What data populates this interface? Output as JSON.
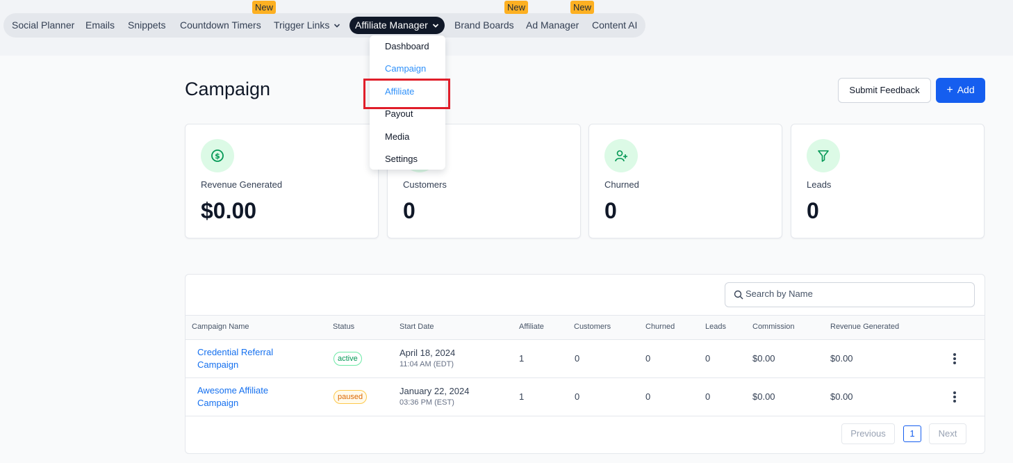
{
  "nav": {
    "items": [
      "Social Planner",
      "Emails",
      "Snippets",
      "Countdown Timers",
      "Trigger Links",
      "Affiliate Manager",
      "Brand Boards",
      "Ad Manager",
      "Content AI"
    ],
    "new_badge": "New"
  },
  "dropdown": {
    "items": [
      "Dashboard",
      "Campaign",
      "Affiliate",
      "Payout",
      "Media",
      "Settings"
    ]
  },
  "page": {
    "title": "Campaign",
    "feedback_label": "Submit Feedback",
    "add_label": "Add"
  },
  "stats": [
    {
      "label": "Revenue Generated",
      "value": "$0.00",
      "icon": "dollar-icon"
    },
    {
      "label": "Customers",
      "value": "0",
      "icon": "users-icon"
    },
    {
      "label": "Churned",
      "value": "0",
      "icon": "user-plus-icon"
    },
    {
      "label": "Leads",
      "value": "0",
      "icon": "funnel-icon"
    }
  ],
  "table": {
    "search_placeholder": "Search by Name",
    "headers": [
      "Campaign Name",
      "Status",
      "Start Date",
      "Affiliate",
      "Customers",
      "Churned",
      "Leads",
      "Commission",
      "Revenue Generated"
    ],
    "rows": [
      {
        "name": "Credential Referral Campaign",
        "status": "active",
        "date": "April 18, 2024",
        "time": "11:04 AM (EDT)",
        "affiliate": "1",
        "customers": "0",
        "churned": "0",
        "leads": "0",
        "commission": "$0.00",
        "revenue": "$0.00"
      },
      {
        "name": "Awesome Affiliate Campaign",
        "status": "paused",
        "date": "January 22, 2024",
        "time": "03:36 PM (EST)",
        "affiliate": "1",
        "customers": "0",
        "churned": "0",
        "leads": "0",
        "commission": "$0.00",
        "revenue": "$0.00"
      }
    ],
    "pagination": {
      "previous": "Previous",
      "page": "1",
      "next": "Next"
    }
  },
  "colors": {
    "accent": "#155eef",
    "highlight": "#e01e2a",
    "nav_active": "#101828",
    "badge": "#fdb022"
  }
}
